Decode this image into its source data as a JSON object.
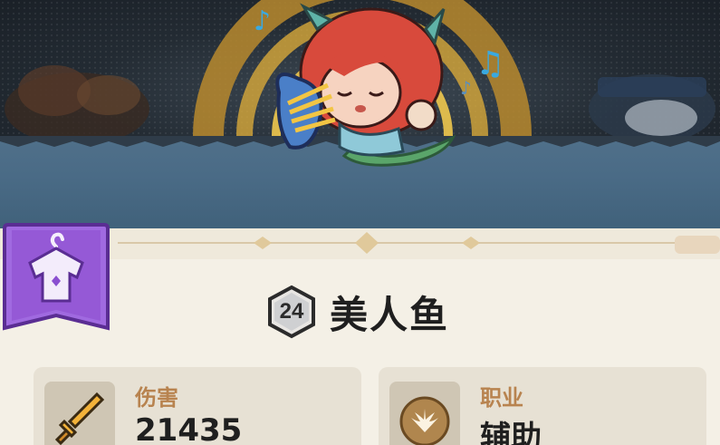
{
  "hero": {
    "level": "24",
    "name": "美人鱼"
  },
  "stats": {
    "damage": {
      "label": "伤害",
      "value": "21435",
      "icon": "sword-icon"
    },
    "role": {
      "label": "职业",
      "value": "辅助",
      "icon": "wings-emblem-icon"
    }
  },
  "skin_button": {
    "icon": "shirt-hanger-icon"
  },
  "colors": {
    "accent_purple": "#9b5bd9",
    "label_gold": "#b8834f",
    "panel_bg": "#f4f0e6",
    "card_bg": "#e7e1d4",
    "band_blue": "#4a6b86"
  }
}
